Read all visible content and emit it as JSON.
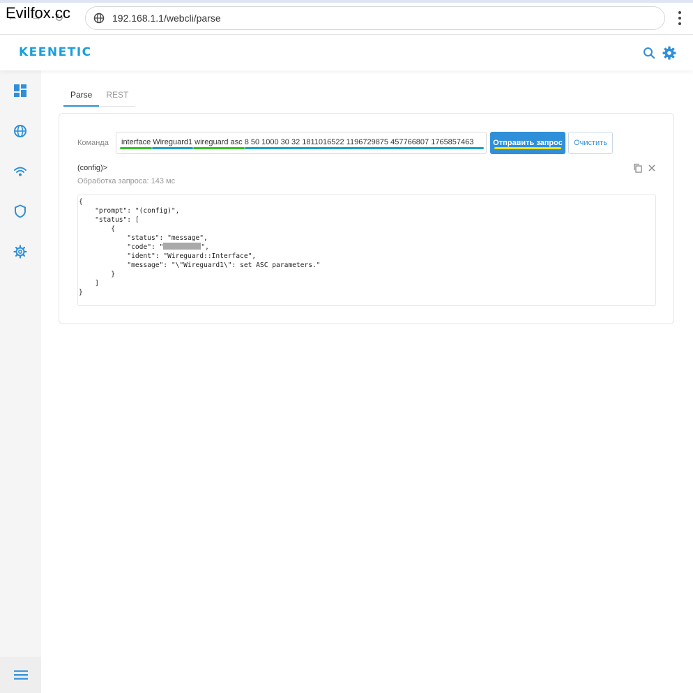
{
  "watermark": "Evilfox.cc",
  "browser": {
    "url": "192.168.1.1/webcli/parse"
  },
  "header": {
    "logo": "KEENETIC"
  },
  "tabs": [
    {
      "label": "Parse",
      "active": true
    },
    {
      "label": "REST",
      "active": false
    }
  ],
  "form": {
    "command_label": "Команда",
    "command_value": "interface Wireguard1 wireguard asc 8 50 1000 30 32 1811016522 1196729875 457766807 1765857463",
    "send_label": "Отправить запрос",
    "clear_label": "Очистить"
  },
  "result": {
    "prompt": "(config)>",
    "timing": "Обработка запроса: 143 мс",
    "lines": {
      "l1": "{",
      "l2": "    \"prompt\": \"(config)\",",
      "l3": "    \"status\": [",
      "l4": "        {",
      "l5": "            \"status\": \"message\",",
      "l6a": "            \"code\": \"",
      "l6b": "\",",
      "l7": "            \"ident\": \"Wireguard::Interface\",",
      "l8": "            \"message\": \"\\\"Wireguard1\\\": set ASC parameters.\"",
      "l9": "        }",
      "l10": "    ]",
      "l11": "}"
    }
  },
  "colors": {
    "accent": "#2f8fd8",
    "logo": "#1aa0d8",
    "underline_green": "#35c42a",
    "underline_teal": "#1aa3c8",
    "underline_yellow": "#f4e200"
  }
}
